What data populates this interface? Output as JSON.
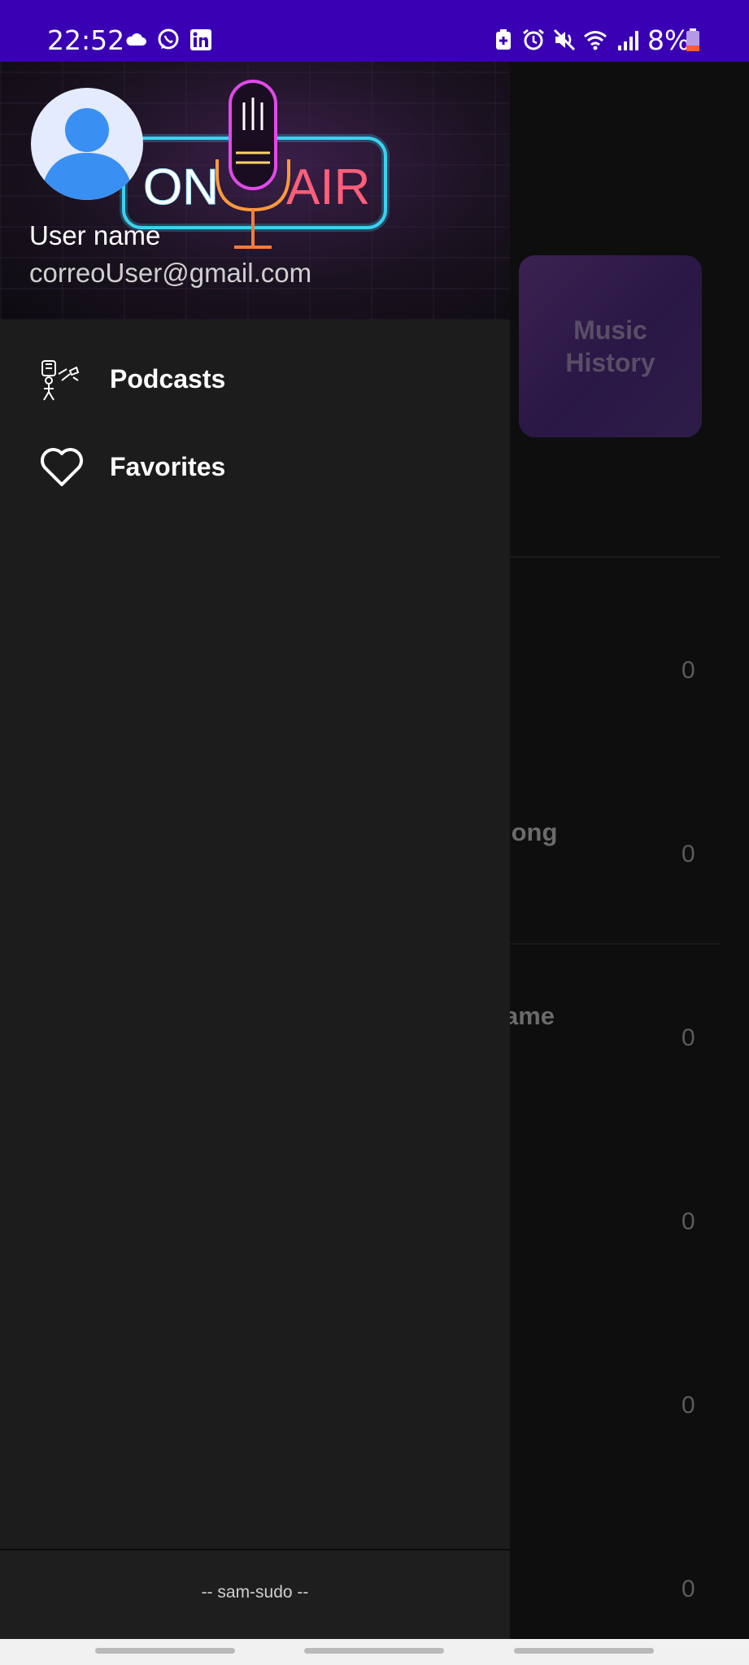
{
  "status_bar": {
    "time": "22:52",
    "battery_percent": "8%",
    "left_icons": [
      "cloud-icon",
      "whatsapp-icon",
      "linkedin-icon"
    ],
    "right_icons": [
      "battery-saver-icon",
      "alarm-icon",
      "mute-icon",
      "wifi-icon",
      "signal-icon",
      "battery-icon"
    ],
    "background_color": "#3a00b4"
  },
  "drawer": {
    "header": {
      "user_name": "User name",
      "user_email": "correoUser@gmail.com",
      "logo": "on-air-neon-logo",
      "logo_text": [
        "ON",
        "AIR"
      ]
    },
    "menu": [
      {
        "label": "Podcasts",
        "icon": "podcast-performer-icon"
      },
      {
        "label": "Favorites",
        "icon": "heart-icon"
      }
    ],
    "footer_text": "-- sam-sudo --"
  },
  "background_app": {
    "card_label": "Music History",
    "partial_labels": [
      "long",
      "ame"
    ],
    "counts": [
      "0",
      "0",
      "0",
      "0",
      "0",
      "0"
    ]
  },
  "colors": {
    "accent": "#3a00b4",
    "drawer_background": "#1c1c1c",
    "card_purple": "#2a1746"
  }
}
